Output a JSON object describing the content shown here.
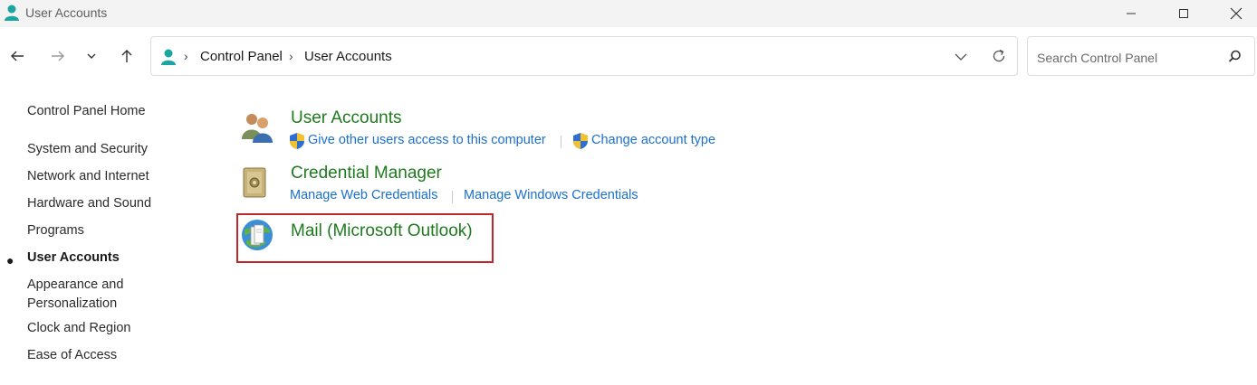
{
  "window": {
    "title": "User Accounts",
    "controls": [
      "minimize",
      "maximize",
      "close"
    ]
  },
  "nav": {
    "back_icon": "arrow-left-icon",
    "forward_icon": "arrow-right-icon",
    "recent_icon": "chevron-down-icon",
    "up_icon": "arrow-up-icon"
  },
  "address": {
    "breadcrumb": [
      "Control Panel",
      "User Accounts"
    ]
  },
  "search": {
    "placeholder": "Search Control Panel"
  },
  "sidebar": {
    "home": "Control Panel Home",
    "items": [
      {
        "label": "System and Security"
      },
      {
        "label": "Network and Internet"
      },
      {
        "label": "Hardware and Sound"
      },
      {
        "label": "Programs"
      },
      {
        "label": "User Accounts",
        "active": true
      },
      {
        "label": "Appearance and"
      },
      {
        "label": "Personalization"
      },
      {
        "label": "Clock and Region"
      },
      {
        "label": "Ease of Access"
      }
    ]
  },
  "categories": [
    {
      "title": "User Accounts",
      "icon": "users-icon",
      "links": [
        "Give other users access to this computer",
        "Change account type"
      ]
    },
    {
      "title": "Credential Manager",
      "icon": "vault-icon",
      "links": [
        "Manage Web Credentials",
        "Manage Windows Credentials"
      ]
    },
    {
      "title": "Mail (Microsoft Outlook)",
      "icon": "mail-globe-icon",
      "links": []
    }
  ],
  "colors": {
    "category_title": "#1f7a1f",
    "link": "#1a6fcf",
    "highlight_border": "#c0272d"
  }
}
